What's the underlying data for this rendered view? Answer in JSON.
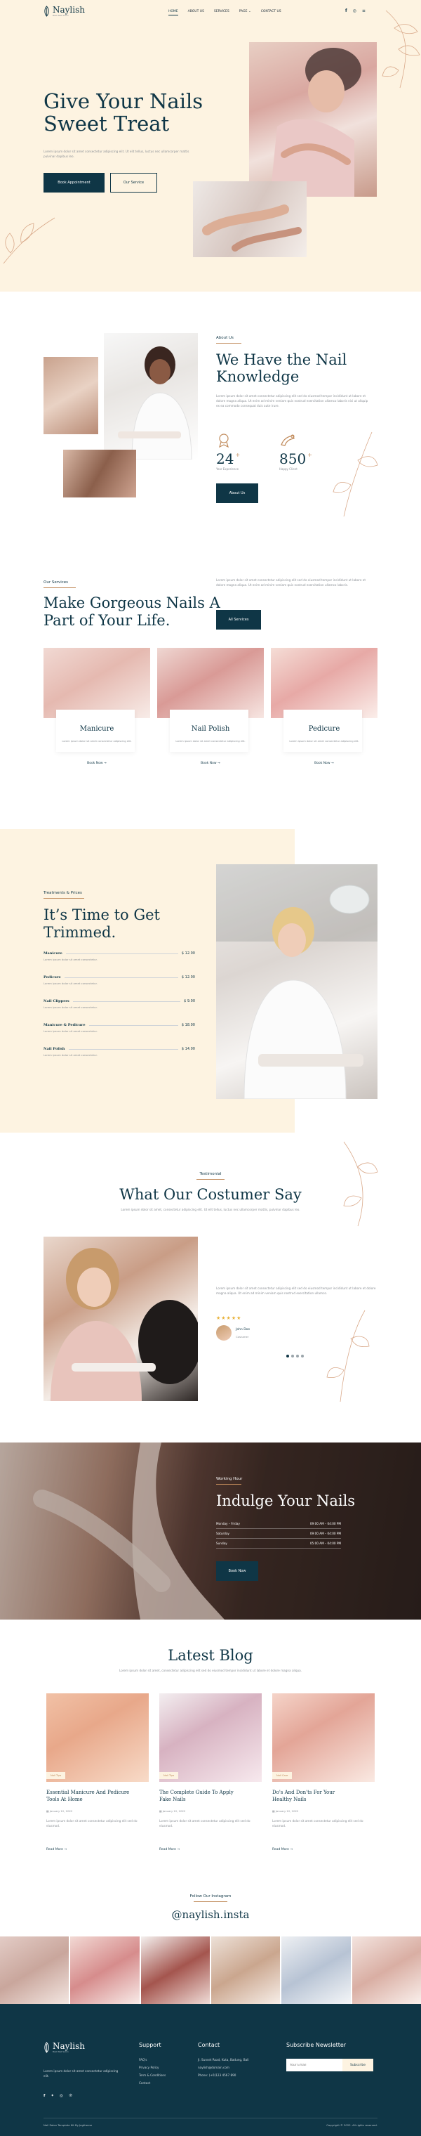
{
  "nav": {
    "logo": "Naylish",
    "logo_tagline": "Best Nail Salon",
    "items": [
      "HOME",
      "ABOUT US",
      "SERVICES",
      "PAGE",
      "CONTACT US"
    ],
    "icons": [
      "facebook-icon",
      "instagram-icon",
      "menu-icon"
    ]
  },
  "hero": {
    "title_line1": "Give Your Nails",
    "title_line2": "Sweet Treat",
    "desc": "Lorem ipsum dolor sit amet consectetur adipiscing elit. Ut elit tellus, luctus nec ullamcorper mattis pulvinar dapibus leo.",
    "btn_primary": "Book Appointment",
    "btn_secondary": "Our Service"
  },
  "about": {
    "label": "About Us",
    "title_line1": "We Have the Nail",
    "title_line2": "Knowledge",
    "desc": "Lorem ipsum dolor sit amet consectetur adipiscing elit sed do eiusmod tempor incididunt ut labore et dolore magna aliqua. Ut enim ad minim veniam quis nostrud exercitation ullamco laboris nisi ut aliquip ex ea commodo consequat duis aute irure.",
    "stat1_value": "24",
    "stat1_sup": "+",
    "stat1_label": "Year Experience",
    "stat2_value": "850",
    "stat2_sup": "+",
    "stat2_label": "Happy Client",
    "button": "About Us"
  },
  "services": {
    "label": "Our Services",
    "title_line1": "Make Gorgeous Nails A",
    "title_line2": "Part of Your Life.",
    "desc": "Lorem ipsum dolor sit amet consectetur adipiscing elit sed do eiusmod tempor incididunt ut labore et dolore magna aliqua. Ut enim ad minim veniam quis nostrud exercitation ullamco laboris.",
    "button": "All Services",
    "cards": [
      {
        "title": "Manicure",
        "desc": "Lorem ipsum dolor sit amet consectetur adipiscing elit.",
        "link": "Book Now"
      },
      {
        "title": "Nail Polish",
        "desc": "Lorem ipsum dolor sit amet consectetur adipiscing elit.",
        "link": "Book Now"
      },
      {
        "title": "Pedicure",
        "desc": "Lorem ipsum dolor sit amet consectetur adipiscing elit.",
        "link": "Book Now"
      }
    ]
  },
  "pricing": {
    "label": "Treatments & Prices",
    "title_line1": "It’s Time to Get",
    "title_line2": "Trimmed.",
    "items": [
      {
        "name": "Manicure",
        "price": "$ 12.00",
        "desc": "Lorem ipsum dolor sit amet consectetur."
      },
      {
        "name": "Pedicure",
        "price": "$ 12.00",
        "desc": "Lorem ipsum dolor sit amet consectetur."
      },
      {
        "name": "Nail Clippers",
        "price": "$ 9.00",
        "desc": "Lorem ipsum dolor sit amet consectetur."
      },
      {
        "name": "Manicure & Pedicure",
        "price": "$ 18.00",
        "desc": "Lorem ipsum dolor sit amet consectetur."
      },
      {
        "name": "Nail Polish",
        "price": "$ 14.00",
        "desc": "Lorem ipsum dolor sit amet consectetur."
      }
    ]
  },
  "testimonial": {
    "label": "Testimonial",
    "title": "What Our Costumer Say",
    "desc": "Lorem ipsum dolor sit amet, consectetur adipiscing elit. Ut elit tellus, luctus nec ullamcorper mattis, pulvinar dapibus leo.",
    "quote": "Lorem ipsum dolor sit amet consectetur adipiscing elit sed do eiusmod tempor incididunt ut labore et dolore magna aliqua. Ut enim ad minim veniam quis nostrud exercitation ullamco.",
    "stars": "★★★★★",
    "name": "John Doe",
    "role": "Costumer"
  },
  "hours": {
    "label": "Working Hour",
    "title": "Indulge Your Nails",
    "rows": [
      {
        "day": "Monday – Friday",
        "time": "09:00 AM – 04:00 PM"
      },
      {
        "day": "Saturday",
        "time": "09:00 AM – 04:00 PM"
      },
      {
        "day": "Sunday",
        "time": "05:00 AM – 04:00 PM"
      }
    ],
    "button": "Book Now"
  },
  "blog": {
    "title": "Latest Blog",
    "desc": "Lorem ipsum dolor sit amet, consectetur adipiscing elit sed do eiusmod tempor incididunt ut labore et dolore magna aliqua.",
    "posts": [
      {
        "tag": "Nail Tips",
        "title_line1": "Essential Manicure And Pedicure",
        "title_line2": "Tools At Home",
        "date": "January 12, 2022",
        "desc": "Lorem ipsum dolor sit amet consectetur adipiscing elit sed do eiusmod.",
        "link": "Read More"
      },
      {
        "tag": "Nail Tips",
        "title_line1": "The Complete Guide To Apply",
        "title_line2": "Fake Nails",
        "date": "January 12, 2022",
        "desc": "Lorem ipsum dolor sit amet consectetur adipiscing elit sed do eiusmod.",
        "link": "Read More"
      },
      {
        "tag": "Nail Care",
        "title_line1": "Do's And Don'ts For Your",
        "title_line2": "Healthy Nails",
        "date": "January 12, 2022",
        "desc": "Lorem ipsum dolor sit amet consectetur adipiscing elit sed do eiusmod.",
        "link": "Read More"
      }
    ]
  },
  "instagram": {
    "label": "Follow Our Instagram",
    "handle": "@naylish.insta"
  },
  "footer": {
    "logo": "Naylish",
    "logo_tagline": "Best Nail Salon",
    "about": "Lorem ipsum dolor sit amet consectetur adipiscing elit.",
    "support_title": "Support",
    "support_links": [
      "FAQ's",
      "Privacy Policy",
      "Term & Conditions",
      "Contact"
    ],
    "contact_title": "Contact",
    "contact_lines": [
      "Jl. Sunset Road, Kuta, Badung, Bali",
      "naylish@domain.com",
      "Phone: (+0)123 4567 890"
    ],
    "newsletter_title": "Subscribe Newsletter",
    "newsletter_placeholder": "Your Email",
    "newsletter_button": "Subscribe",
    "copyright_left": "Nail Salon Template Kit By Jegtheme",
    "copyright_right": "Copyright © 2022. All rights reserved."
  }
}
